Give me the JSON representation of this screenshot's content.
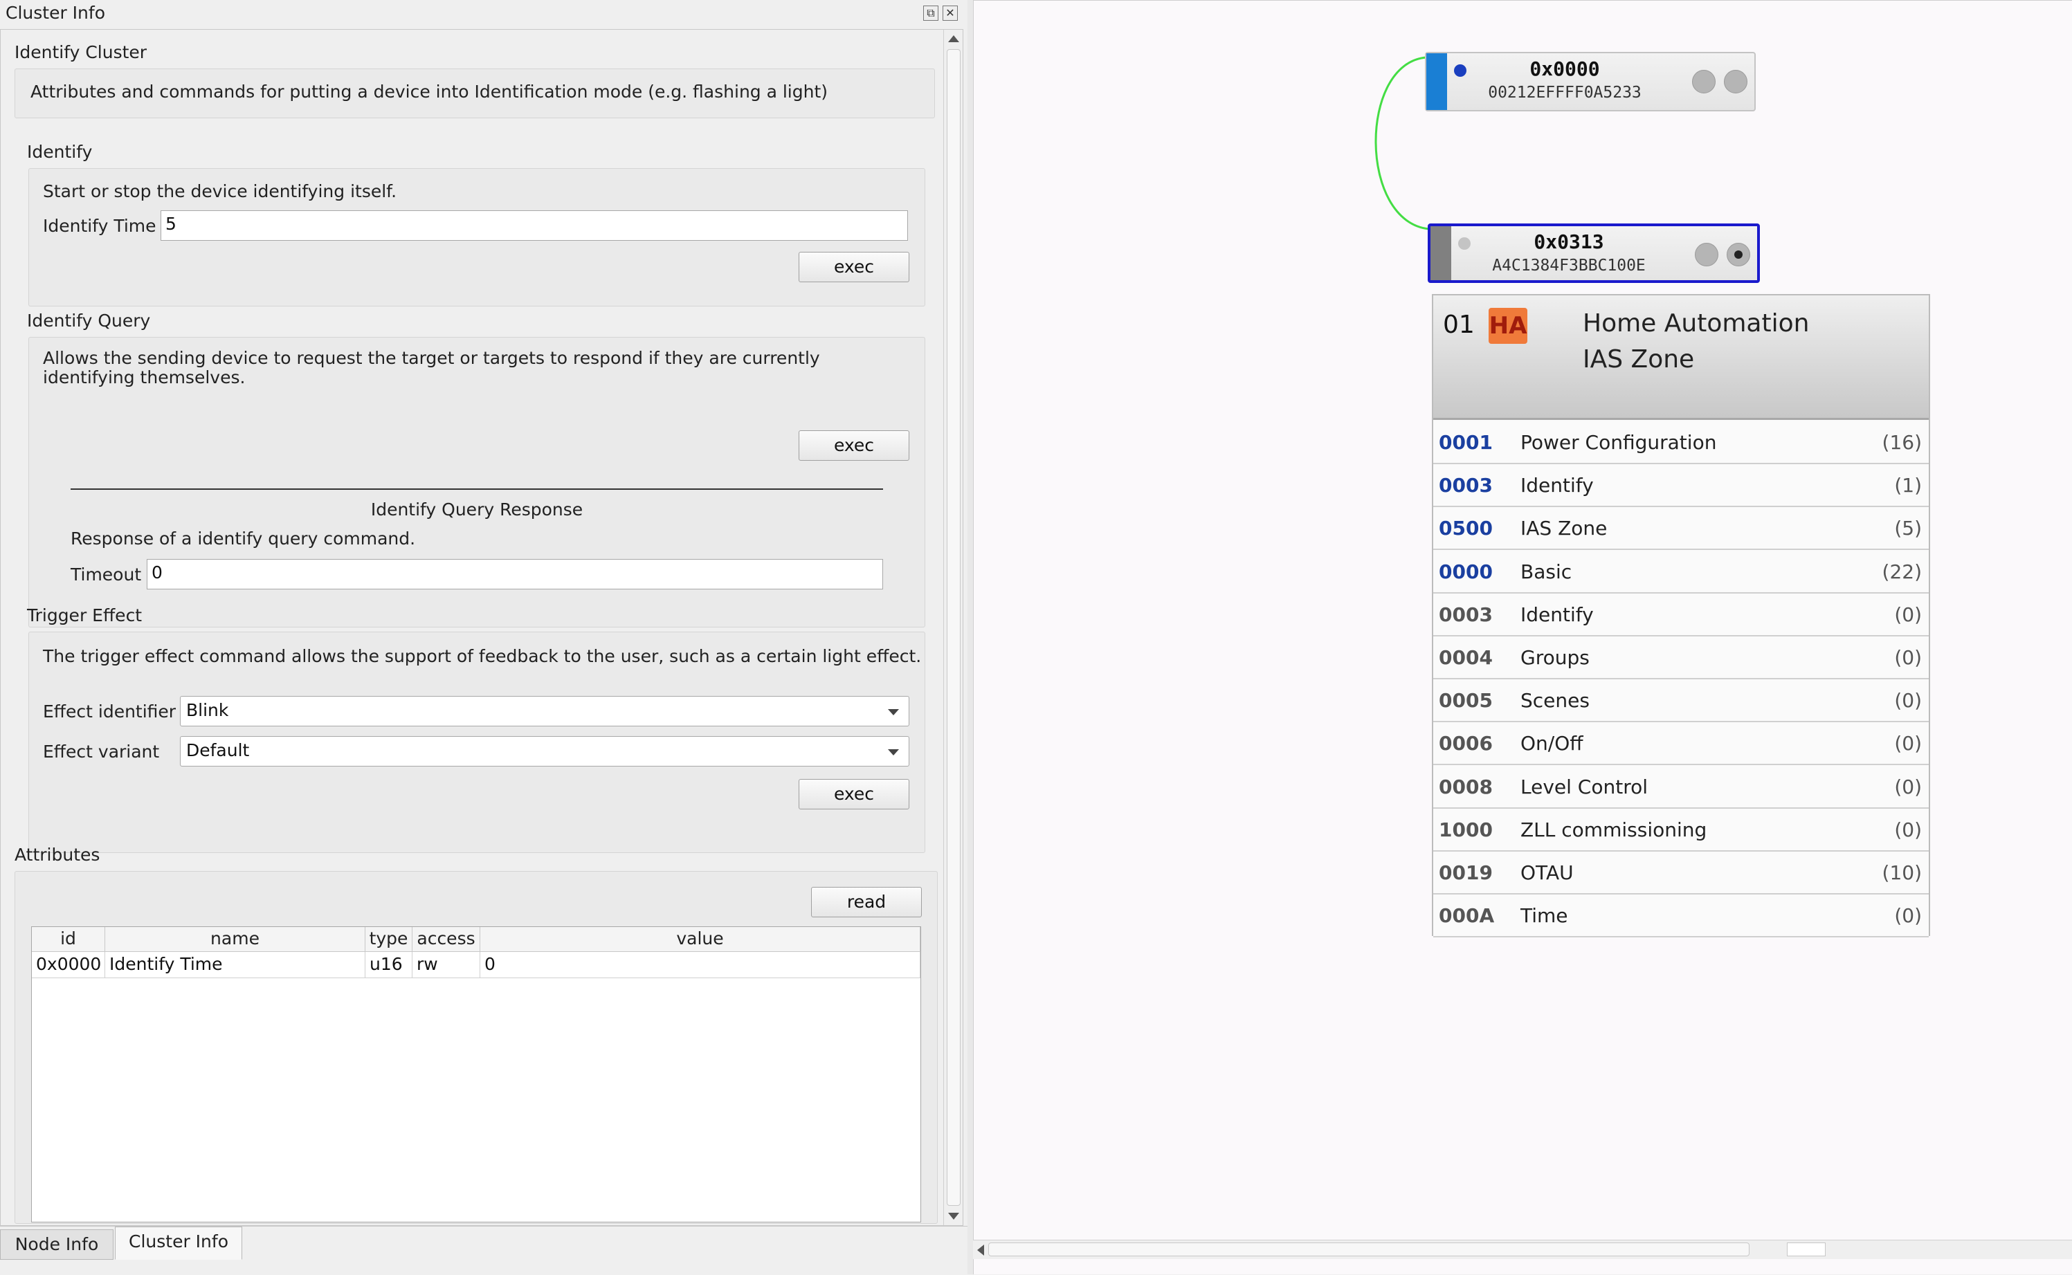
{
  "dock": {
    "title": "Cluster Info",
    "float_glyph": "⧉",
    "close_glyph": "✕"
  },
  "cluster": {
    "title": "Identify Cluster",
    "description": "Attributes and commands for putting a device into Identification mode (e.g. flashing a light)"
  },
  "identify": {
    "title": "Identify",
    "description": "Start or stop the device identifying itself.",
    "time_label": "Identify Time",
    "time_value": "5",
    "exec_label": "exec"
  },
  "identify_query": {
    "title": "Identify Query",
    "description": "Allows the sending device to request the target or targets to respond if they are currently identifying themselves.",
    "exec_label": "exec",
    "response": {
      "title": "Identify Query Response",
      "description": "Response of a identify query command.",
      "timeout_label": "Timeout",
      "timeout_value": "0"
    }
  },
  "trigger_effect": {
    "title": "Trigger Effect",
    "description": "The trigger effect command allows the support of feedback to the user, such as a certain light effect.",
    "effect_id_label": "Effect identifier",
    "effect_id_value": "Blink",
    "effect_variant_label": "Effect variant",
    "effect_variant_value": "Default",
    "exec_label": "exec"
  },
  "attributes": {
    "title": "Attributes",
    "read_label": "read",
    "columns": [
      "id",
      "name",
      "type",
      "access",
      "value"
    ],
    "rows": [
      {
        "id": "0x0000",
        "name": "Identify Time",
        "type": "u16",
        "access": "rw",
        "value": "0"
      }
    ]
  },
  "tabs": {
    "node_info": "Node Info",
    "cluster_info": "Cluster Info",
    "active": "cluster_info"
  },
  "graph": {
    "nodes": [
      {
        "addr": "0x0000",
        "mac": "00212EFFFF0A5233",
        "strip_color": "#1a7fd4",
        "led_color": "#1a3fbf",
        "selected": false
      },
      {
        "addr": "0x0313",
        "mac": "A4C1384F3BBC100E",
        "strip_color": "#808080",
        "led_color": "#c4c4c4",
        "selected": true
      }
    ],
    "link_color": "#44dd44",
    "endpoint": {
      "number": "01",
      "badge": "HA",
      "profile": "Home Automation",
      "device": "IAS Zone"
    },
    "clusters": [
      {
        "id": "0001",
        "name": "Power Configuration",
        "count": "(16)",
        "server": true
      },
      {
        "id": "0003",
        "name": "Identify",
        "count": "(1)",
        "server": true
      },
      {
        "id": "0500",
        "name": "IAS Zone",
        "count": "(5)",
        "server": true
      },
      {
        "id": "0000",
        "name": "Basic",
        "count": "(22)",
        "server": true
      },
      {
        "id": "0003",
        "name": "Identify",
        "count": "(0)",
        "server": false
      },
      {
        "id": "0004",
        "name": "Groups",
        "count": "(0)",
        "server": false
      },
      {
        "id": "0005",
        "name": "Scenes",
        "count": "(0)",
        "server": false
      },
      {
        "id": "0006",
        "name": "On/Off",
        "count": "(0)",
        "server": false
      },
      {
        "id": "0008",
        "name": "Level Control",
        "count": "(0)",
        "server": false
      },
      {
        "id": "1000",
        "name": "ZLL commissioning",
        "count": "(0)",
        "server": false
      },
      {
        "id": "0019",
        "name": "OTAU",
        "count": "(10)",
        "server": false
      },
      {
        "id": "000A",
        "name": "Time",
        "count": "(0)",
        "server": false
      }
    ],
    "colors": {
      "server_id": "#1a3fa0",
      "client_id": "#555555",
      "selected_border": "#1a1acc"
    }
  }
}
